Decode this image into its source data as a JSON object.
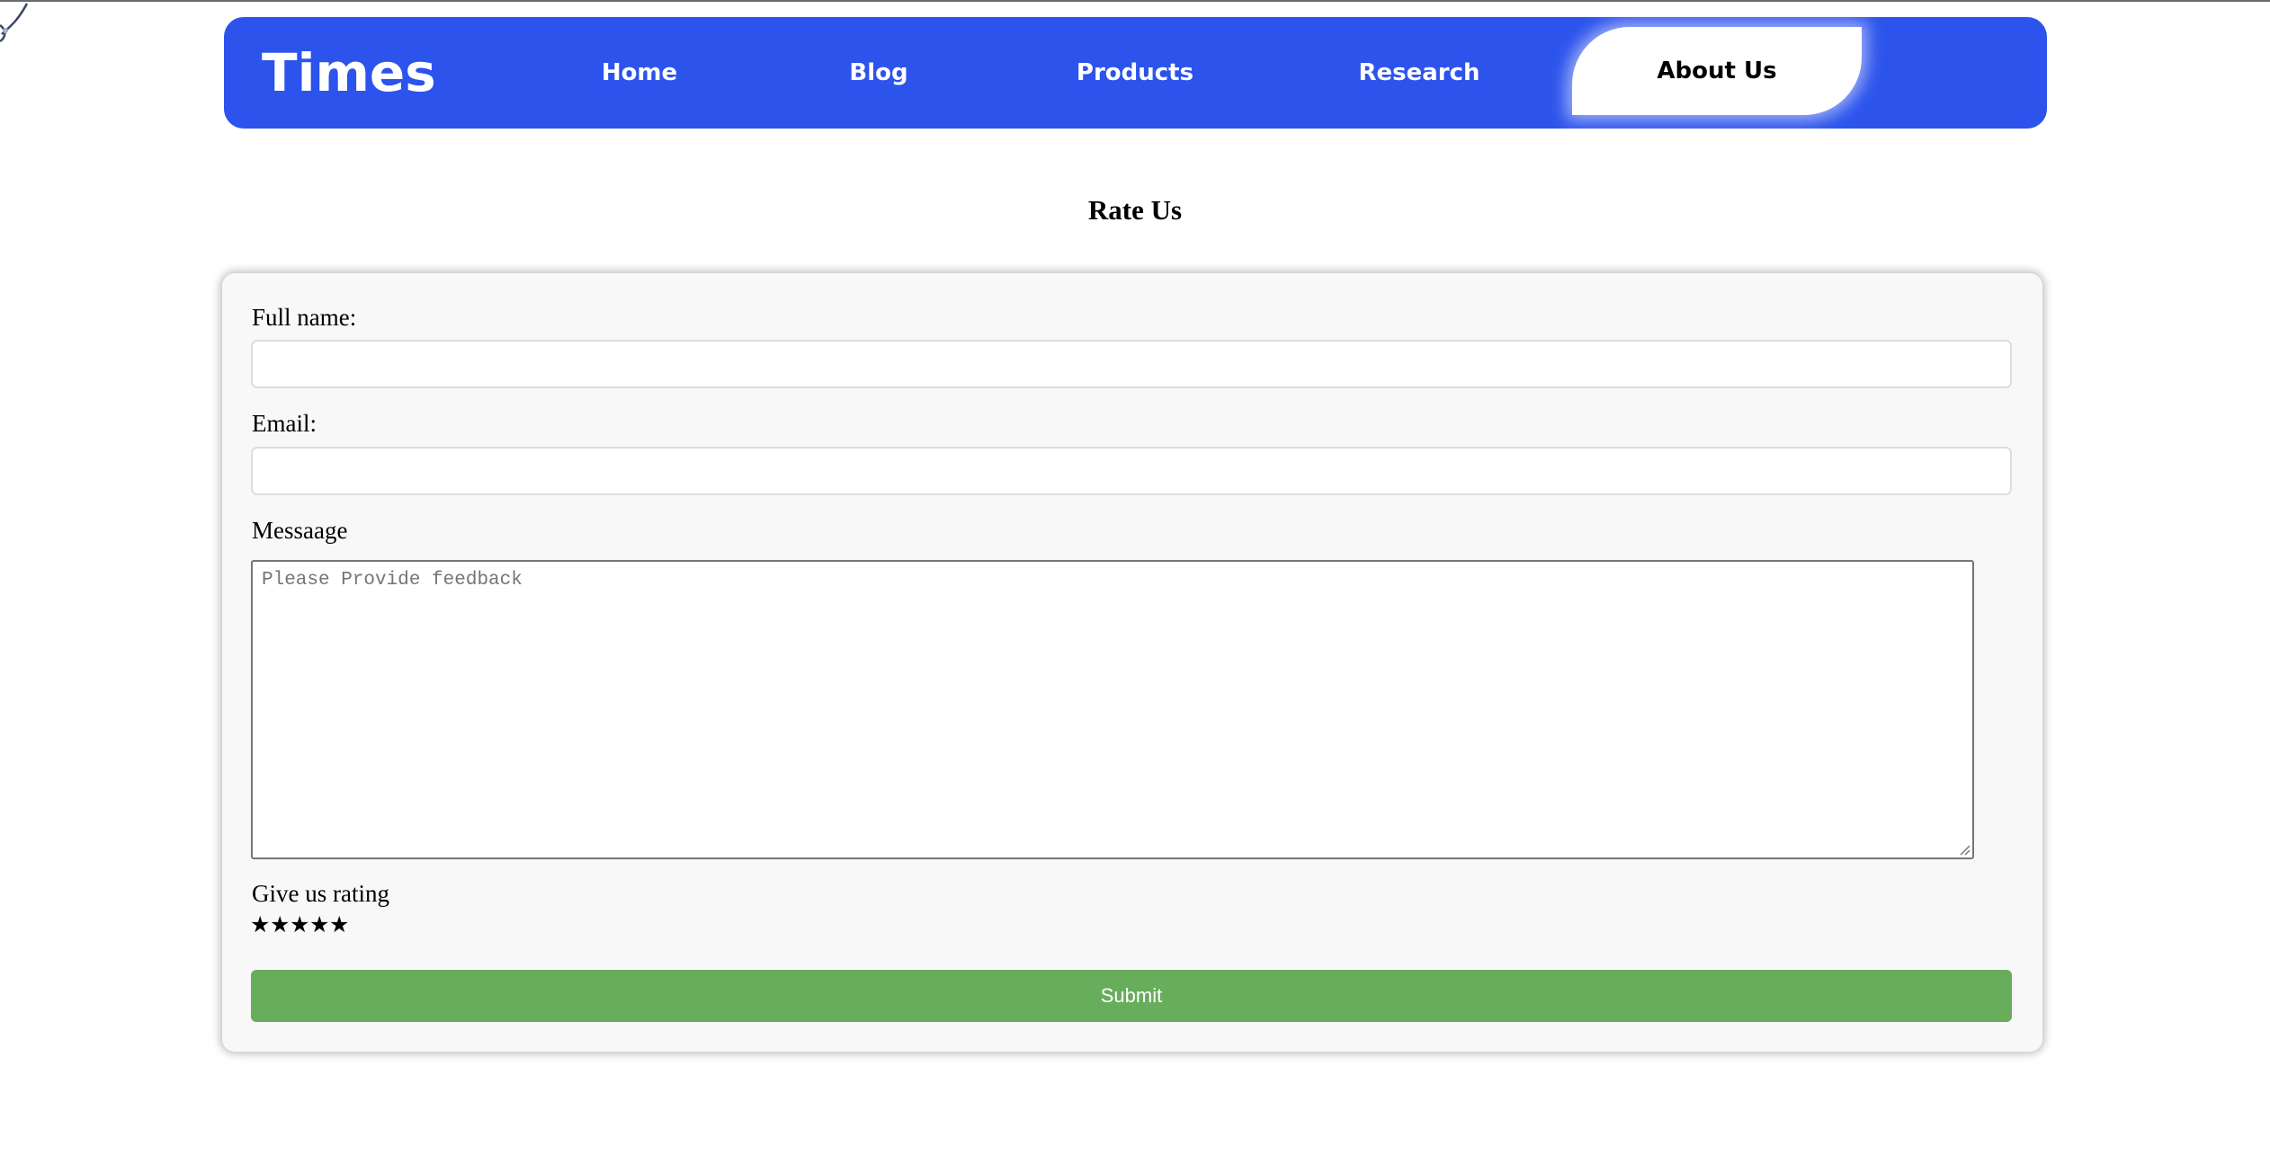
{
  "nav": {
    "brand": "Times",
    "accent": "#2c53ec",
    "items": [
      {
        "label": "Home",
        "active": false
      },
      {
        "label": "Blog",
        "active": false
      },
      {
        "label": "Products",
        "active": false
      },
      {
        "label": "Research",
        "active": false
      },
      {
        "label": "About Us",
        "active": true
      }
    ]
  },
  "page": {
    "title": "Rate Us"
  },
  "form": {
    "full_name_label": "Full name:",
    "full_name_value": "",
    "email_label": "Email:",
    "email_value": "",
    "message_label": "Messaage",
    "message_placeholder": "Please Provide feedback",
    "rating_label": "Give us rating",
    "rating": {
      "filled": 5,
      "max": 5
    },
    "star_glyph": "★",
    "submit_label": "Submit",
    "submit_color": "#68ad5c"
  }
}
